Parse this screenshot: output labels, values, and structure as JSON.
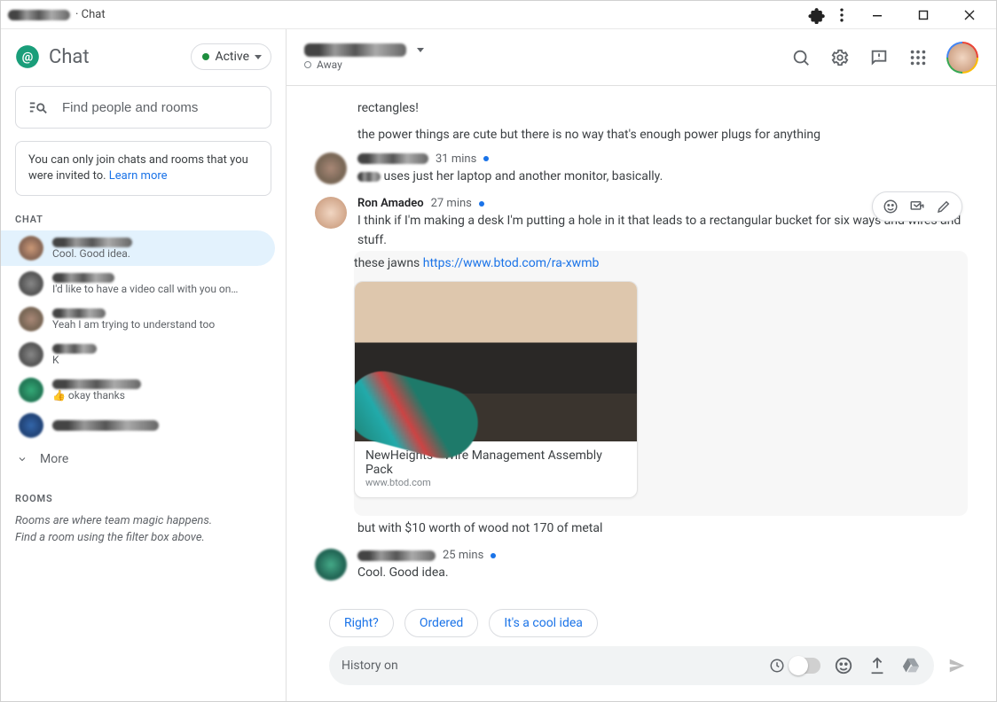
{
  "titlebar": {
    "suffix": " · Chat"
  },
  "sidebar": {
    "brand": "Chat",
    "status_label": "Active",
    "search_placeholder": "Find people and rooms",
    "notice_text": "You can only join chats and rooms that you were invited to. ",
    "notice_link": "Learn more",
    "chat_label": "CHAT",
    "items": [
      {
        "preview": "Cool. Good idea."
      },
      {
        "preview": "I'd like to have a video call with you on …"
      },
      {
        "preview": "Yeah I am trying to understand too"
      },
      {
        "preview": "K"
      },
      {
        "preview": "👍 okay thanks"
      },
      {
        "preview": ""
      }
    ],
    "more_label": "More",
    "rooms_label": "ROOMS",
    "rooms_hint_line1": "Rooms are where team magic happens.",
    "rooms_hint_line2": "Find a room using the filter box above."
  },
  "header": {
    "away_label": "Away"
  },
  "thread": {
    "pre1": "rectangles!",
    "pre2": "the power things are cute but there is no way that's enough power plugs for anything",
    "msg1": {
      "time": "31 mins",
      "text_after_smudge": " uses just her laptop and another monitor, basically."
    },
    "msg2": {
      "who": "Ron Amadeo",
      "time": "27 mins",
      "line1": "I think if I'm making a desk I'm putting a hole in it that leads to a rectangular bucket for six ways and wires and stuff.",
      "line2_pre": "these jawns ",
      "link_text": "https://www.btod.com/ra-xwmb",
      "card_title": "NewHeights™ Wire Management Assembly Pack",
      "card_domain": "www.btod.com",
      "line3": "but with $10 worth of wood not 170 of metal"
    },
    "msg3": {
      "time": "25 mins",
      "text": "Cool. Good idea."
    }
  },
  "suggestions": [
    "Right?",
    "Ordered",
    "It's a cool idea"
  ],
  "compose": {
    "text": "History on"
  }
}
